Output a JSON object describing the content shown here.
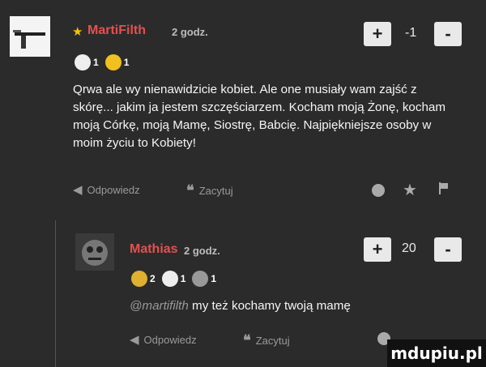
{
  "comment1": {
    "star": "★",
    "author": "MartiFilth",
    "time": "2 godz.",
    "score": "-1",
    "badges": [
      {
        "count": "1"
      },
      {
        "count": "1"
      }
    ],
    "body": "Qrwa ale wy nienawidzicie kobiet. Ale one musiały wam zajść z skórę... jakim ja jestem szczęściarzem. Kocham moją Żonę, kocham moją Córkę, moją Mamę, Siostrę, Babcię. Najpiękniejsze osoby w moim życiu to Kobiety!",
    "actions": {
      "reply": "Odpowiedz",
      "quote": "Zacytuj"
    }
  },
  "comment2": {
    "author": "Mathias",
    "time": "2 godz.",
    "score": "20",
    "badges": [
      {
        "count": "2"
      },
      {
        "count": "1"
      },
      {
        "count": "1"
      }
    ],
    "mention": "@martifilth",
    "text": "my też kochamy twoją mamę",
    "actions": {
      "reply": "Odpowiedz",
      "quote": "Zacytuj"
    }
  },
  "vote": {
    "plus": "+",
    "minus": "-"
  },
  "watermark": "mdupiu.pl",
  "colors": {
    "author_red": "#e45050",
    "background": "#2b2b2b"
  }
}
